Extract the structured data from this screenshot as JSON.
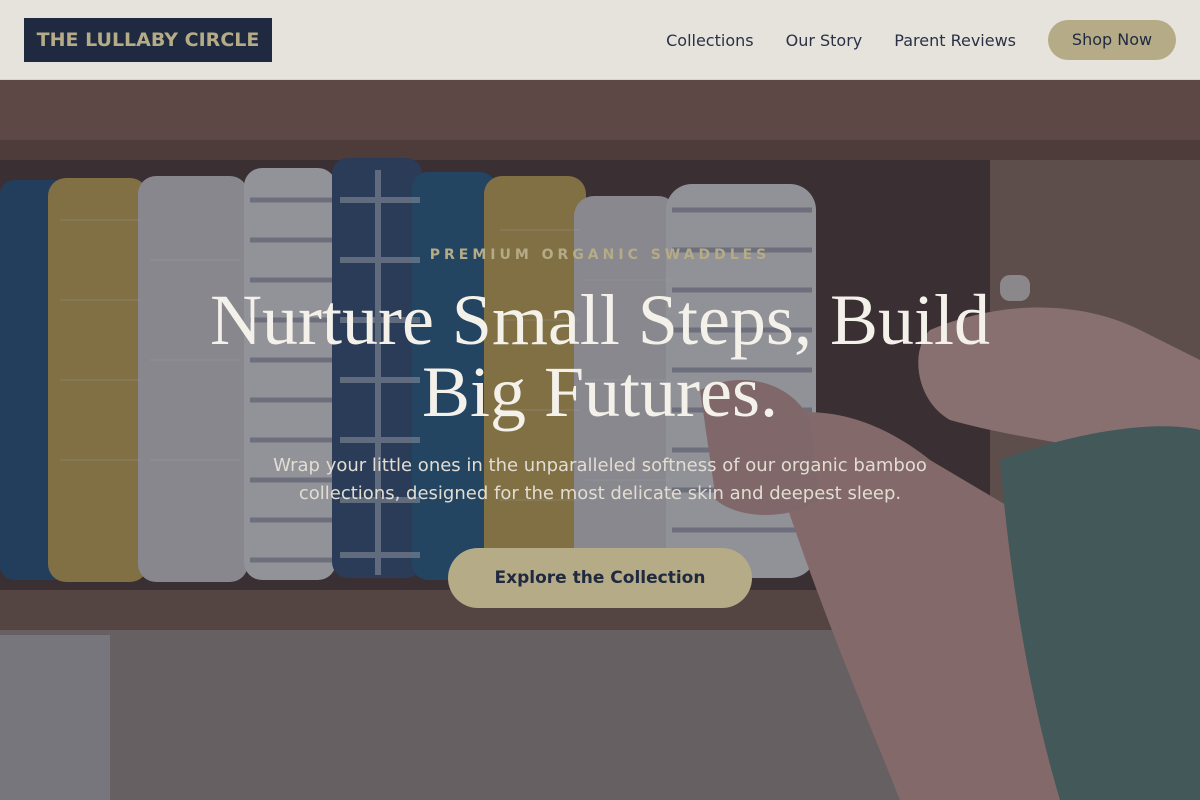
{
  "header": {
    "logo_text": "THE LULLABY CIRCLE",
    "nav": [
      {
        "label": "Collections"
      },
      {
        "label": "Our Story"
      },
      {
        "label": "Parent Reviews"
      }
    ],
    "shop_label": "Shop Now"
  },
  "hero": {
    "eyebrow": "PREMIUM ORGANIC SWADDLES",
    "headline": "Nurture Small Steps, Build Big Futures.",
    "subtext": "Wrap your little ones in the unparalleled softness of our organic bamboo collections, designed for the most delicate skin and deepest sleep.",
    "cta_label": "Explore the Collection"
  },
  "colors": {
    "brand_navy": "#1f2940",
    "brand_gold": "#b5ab87",
    "header_bg": "#ecEAE4"
  }
}
